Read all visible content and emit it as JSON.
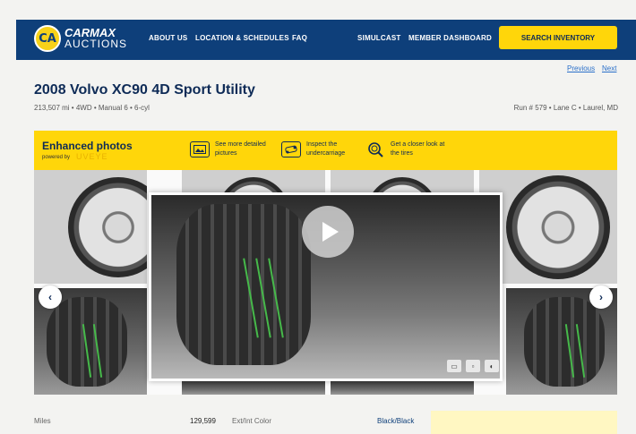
{
  "brand": {
    "badge": "CA",
    "line1": "CARMAX",
    "line2": "AUCTIONS"
  },
  "nav": {
    "about": "ABOUT US",
    "locations": "LOCATION & SCHEDULES",
    "faq": "FAQ",
    "simulcast": "SIMULCAST",
    "dashboard": "MEMBER DASHBOARD",
    "search": "SEARCH INVENTORY"
  },
  "pager": {
    "previous": "Previous",
    "next": "Next"
  },
  "vehicle": {
    "title": "2008 Volvo XC90 4D Sport Utility",
    "specs": "213,507 mi • 4WD • Manual 6 • 6-cyl",
    "run": "Run # 579 • Lane C • Laurel, MD"
  },
  "banner": {
    "title": "Enhanced photos",
    "powered_by": "powered by",
    "partner": "UVEYE",
    "features": [
      {
        "icon": "photo-icon",
        "text": "See more detailed pictures"
      },
      {
        "icon": "car-underside-icon",
        "text": "Inspect the undercarriage"
      },
      {
        "icon": "magnifier-icon",
        "text": "Get a closer look at the tires"
      }
    ]
  },
  "gallery": {
    "prev_icon": "chevron-left-icon",
    "next_icon": "chevron-right-icon",
    "play_icon": "play-icon"
  },
  "details": {
    "miles_label": "Miles",
    "miles_value": "129,599",
    "color_label": "Ext/Int Color",
    "color_value": "Black/Black"
  },
  "colors": {
    "nav": "#0e3f7a",
    "accent": "#ffd60a"
  }
}
